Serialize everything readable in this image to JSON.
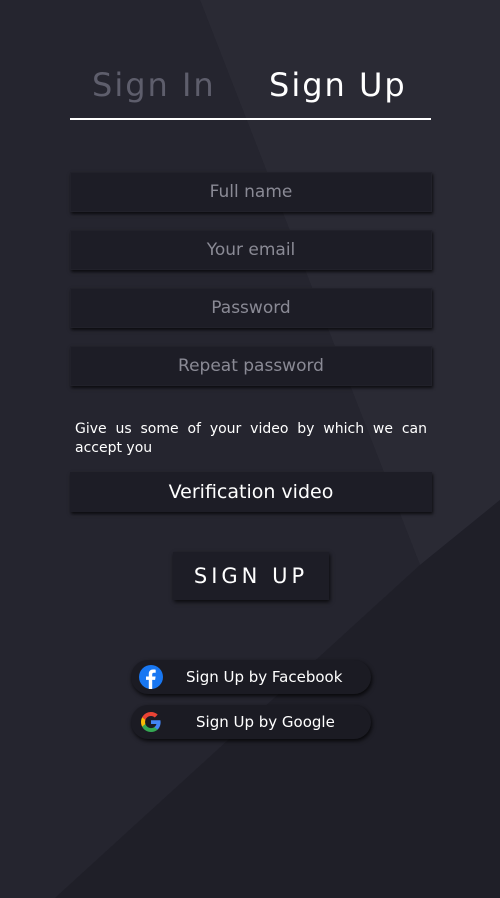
{
  "tabs": {
    "sign_in": "Sign In",
    "sign_up": "Sign Up",
    "active": "sign_up"
  },
  "form": {
    "full_name_placeholder": "Full name",
    "email_placeholder": "Your email",
    "password_placeholder": "Password",
    "repeat_password_placeholder": "Repeat password"
  },
  "video": {
    "note": "Give us some of your video by which we can accept you",
    "button_label": "Verification video"
  },
  "signup_button_label": "SIGN UP",
  "social": {
    "facebook_label": "Sign Up by Facebook",
    "facebook_icon": "facebook-icon",
    "google_label": "Sign Up by Google",
    "google_icon": "google-icon"
  },
  "colors": {
    "background": "#23232d",
    "field_background": "#1d1d26",
    "inactive_tab": "#5e5e6c",
    "facebook_blue": "#1877f2"
  }
}
